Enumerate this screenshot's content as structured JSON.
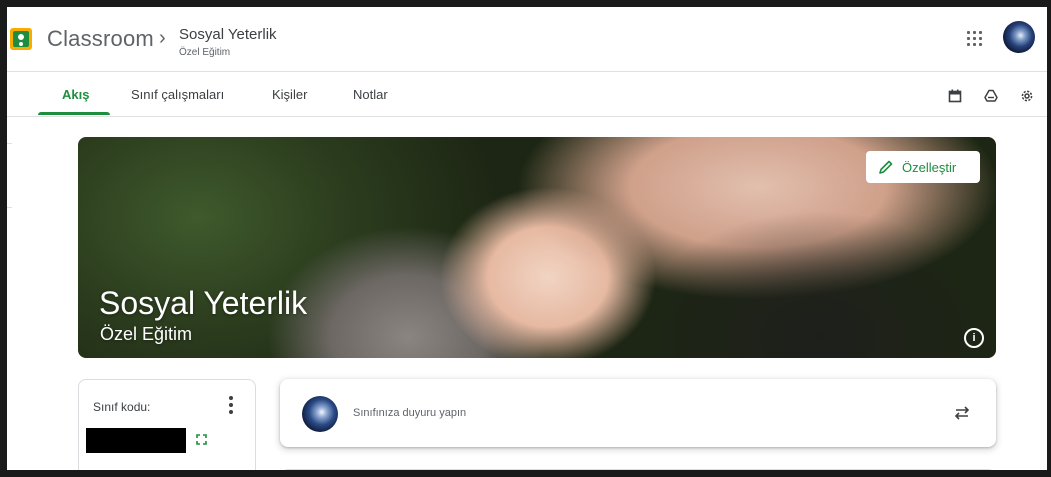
{
  "app": {
    "title": "Classroom",
    "breadcrumb_separator": "›",
    "class_name": "Sosyal Yeterlik",
    "class_section": "Özel Eğitim"
  },
  "header_icons": [
    "apps-icon",
    "account-avatar"
  ],
  "tabs": [
    {
      "label": "Akış",
      "active": true
    },
    {
      "label": "Sınıf çalışmaları",
      "active": false
    },
    {
      "label": "Kişiler",
      "active": false
    },
    {
      "label": "Notlar",
      "active": false
    }
  ],
  "toolbar_icons": [
    "calendar-icon",
    "drive-icon",
    "settings-icon"
  ],
  "banner": {
    "title": "Sosyal Yeterlik",
    "subtitle": "Özel Eğitim",
    "customize_label": "Özelleştir",
    "info_glyph": "i"
  },
  "class_code": {
    "label": "Sınıf kodu:",
    "value_hidden": true
  },
  "announce": {
    "placeholder": "Sınıfınıza duyuru yapın"
  },
  "colors": {
    "accent": "#1e8e3e",
    "text": "#3c4043",
    "muted": "#5f6368",
    "divider": "#e0e0e0"
  }
}
